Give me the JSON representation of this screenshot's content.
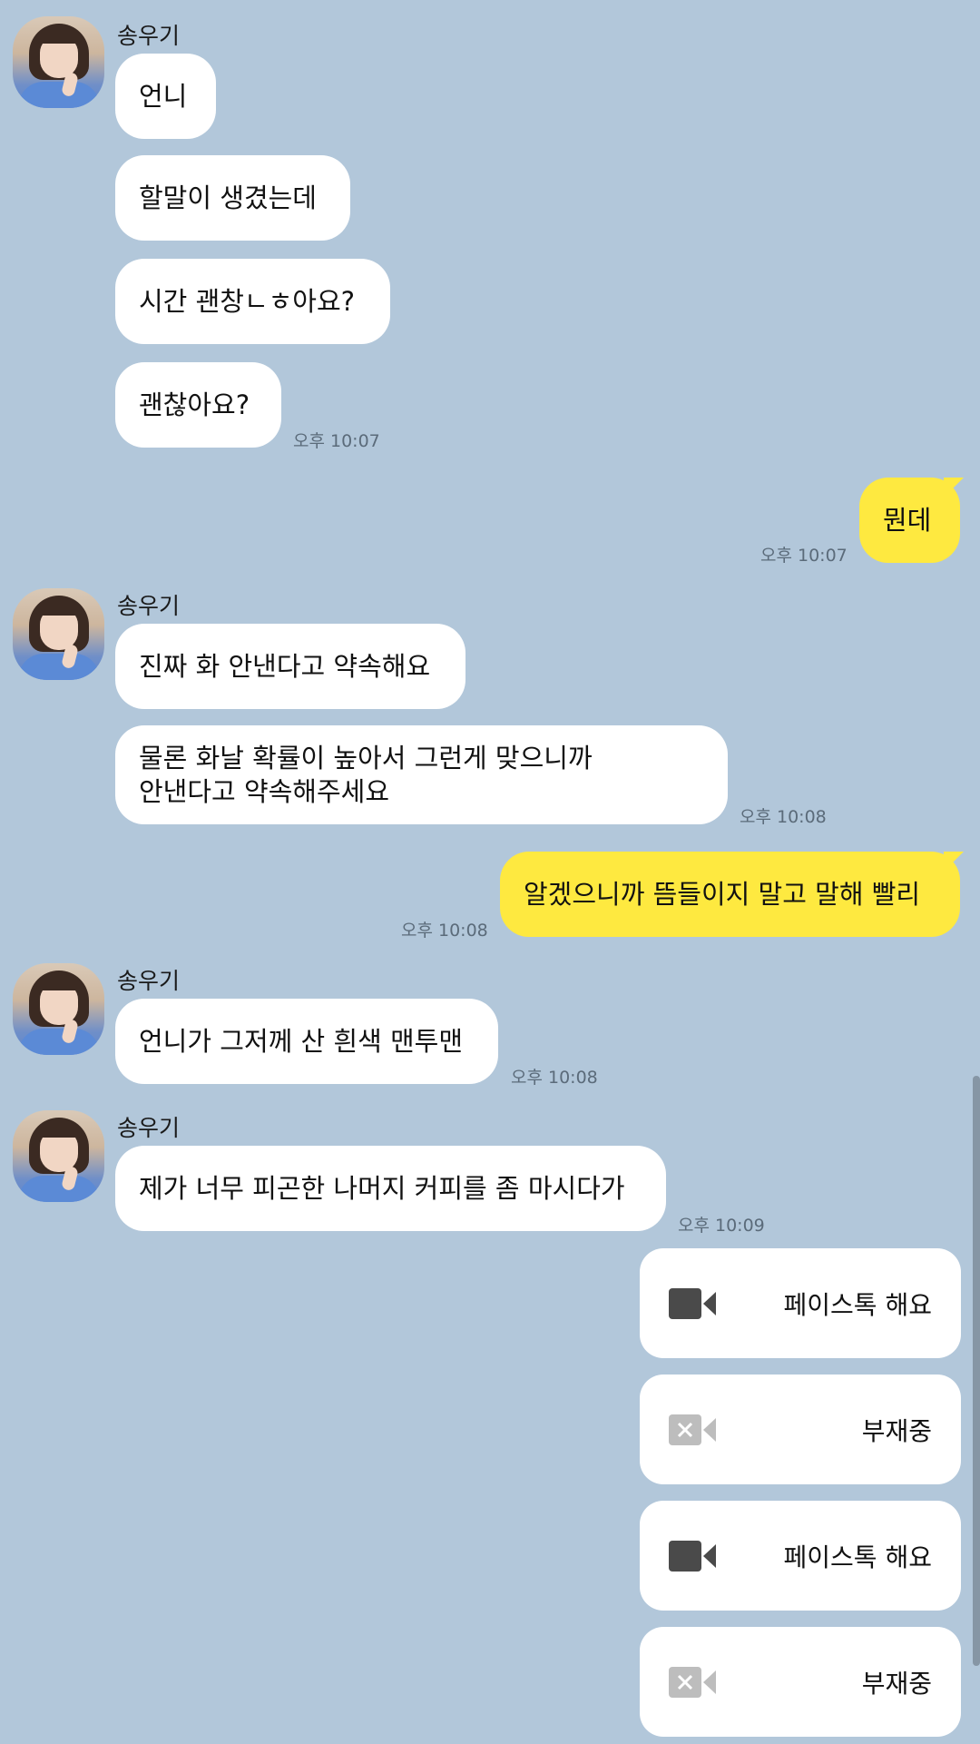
{
  "contact": {
    "name": "송우기"
  },
  "messages": {
    "g1": {
      "b1": "언니",
      "b2": "할말이 생겼는데",
      "b3": "시간 괜창ㄴㅎ아요?",
      "b4": "괜찮아요?",
      "time": "오후 10:07"
    },
    "m1": {
      "text": "뭔데",
      "time": "오후 10:07"
    },
    "g2": {
      "b1": "진짜 화 안낸다고 약속해요",
      "b2_line1": "물론 화날 확률이 높아서 그런게 맞으니까",
      "b2_line2": "안낸다고 약속해주세요",
      "time": "오후 10:08"
    },
    "m2": {
      "text": "알겠으니까 뜸들이지 말고 말해 빨리",
      "time": "오후 10:08"
    },
    "g3": {
      "b1": "언니가 그저께 산 흰색 맨투맨",
      "time": "오후 10:08"
    },
    "g4": {
      "b1": "제가 너무 피곤한 나머지 커피를 좀 마시다가",
      "time": "오후 10:09"
    }
  },
  "calls": [
    {
      "label": "페이스톡 해요",
      "icon": "video-camera-icon"
    },
    {
      "label": "부재중",
      "icon": "missed-video-call-icon"
    },
    {
      "label": "페이스톡 해요",
      "icon": "video-camera-icon"
    },
    {
      "label": "부재중",
      "icon": "missed-video-call-icon"
    }
  ],
  "colors": {
    "background": "#b2c7da",
    "my_bubble": "#fee940",
    "their_bubble": "#ffffff",
    "timestamp": "#5b6b7a"
  }
}
